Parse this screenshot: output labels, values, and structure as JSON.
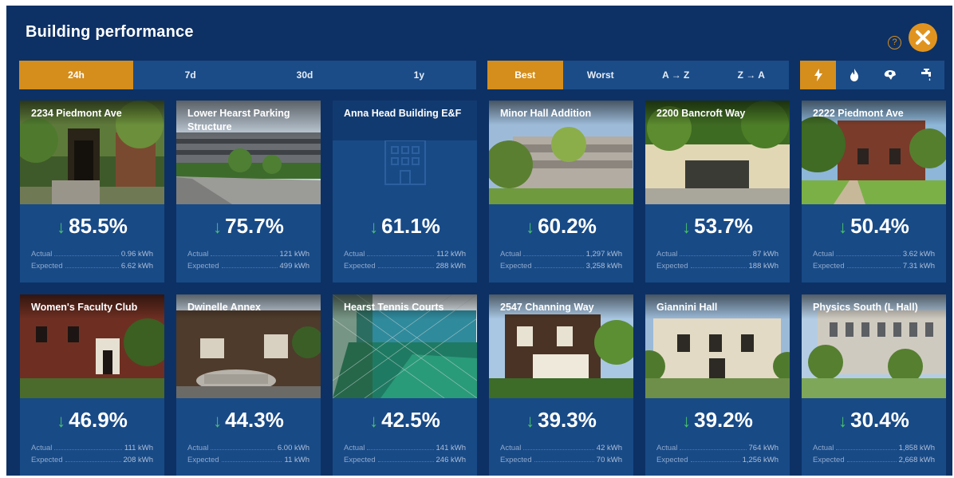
{
  "title": "Building performance",
  "help_label": "?",
  "colors": {
    "background": "#0d3165",
    "card": "#184a86",
    "accent": "#d58e1c",
    "down_arrow": "#49c46a"
  },
  "time_filters": [
    "24h",
    "7d",
    "30d",
    "1y"
  ],
  "time_active": "24h",
  "sort_filters": [
    "Best",
    "Worst",
    "A → Z",
    "Z → A"
  ],
  "sort_active": "Best",
  "resource_filters": [
    {
      "icon": "lightning-icon",
      "glyph": "⚡"
    },
    {
      "icon": "flame-icon",
      "glyph": "🔥"
    },
    {
      "icon": "steam-icon",
      "glyph": "♨"
    },
    {
      "icon": "water-faucet-icon",
      "glyph": "🚰"
    }
  ],
  "resource_active": "lightning-icon",
  "labels": {
    "actual": "Actual",
    "expected": "Expected",
    "arrow": "↓"
  },
  "buildings": [
    {
      "name": "2234 Piedmont Ave",
      "pct": "85.5%",
      "actual": "0.96 kWh",
      "expected": "6.62 kWh",
      "photo": "entrance-trees"
    },
    {
      "name": "Lower Hearst Parking Structure",
      "pct": "75.7%",
      "actual": "121 kWh",
      "expected": "499 kWh",
      "photo": "parking-structure"
    },
    {
      "name": "Anna Head Building E&F",
      "pct": "61.1%",
      "actual": "112 kWh",
      "expected": "288 kWh",
      "photo": "none"
    },
    {
      "name": "Minor Hall Addition",
      "pct": "60.2%",
      "actual": "1,297 kWh",
      "expected": "3,258 kWh",
      "photo": "modern-hall"
    },
    {
      "name": "2200 Bancroft Way",
      "pct": "53.7%",
      "actual": "87 kWh",
      "expected": "188 kWh",
      "photo": "low-building"
    },
    {
      "name": "2222 Piedmont Ave",
      "pct": "50.4%",
      "actual": "3.62 kWh",
      "expected": "7.31 kWh",
      "photo": "brick-house"
    },
    {
      "name": "Women's Faculty Club",
      "pct": "46.9%",
      "actual": "111 kWh",
      "expected": "208 kWh",
      "photo": "brick-club"
    },
    {
      "name": "Dwinelle Annex",
      "pct": "44.3%",
      "actual": "6.00 kWh",
      "expected": "11 kWh",
      "photo": "shingle-house-car"
    },
    {
      "name": "Hearst Tennis Courts",
      "pct": "42.5%",
      "actual": "141 kWh",
      "expected": "246 kWh",
      "photo": "tennis-court"
    },
    {
      "name": "2547 Channing Way",
      "pct": "39.3%",
      "actual": "42 kWh",
      "expected": "70 kWh",
      "photo": "victorian-house"
    },
    {
      "name": "Giannini Hall",
      "pct": "39.2%",
      "actual": "764 kWh",
      "expected": "1,256 kWh",
      "photo": "classical-hall"
    },
    {
      "name": "Physics South (L Hall)",
      "pct": "30.4%",
      "actual": "1,858 kWh",
      "expected": "2,668 kWh",
      "photo": "large-hall"
    }
  ]
}
